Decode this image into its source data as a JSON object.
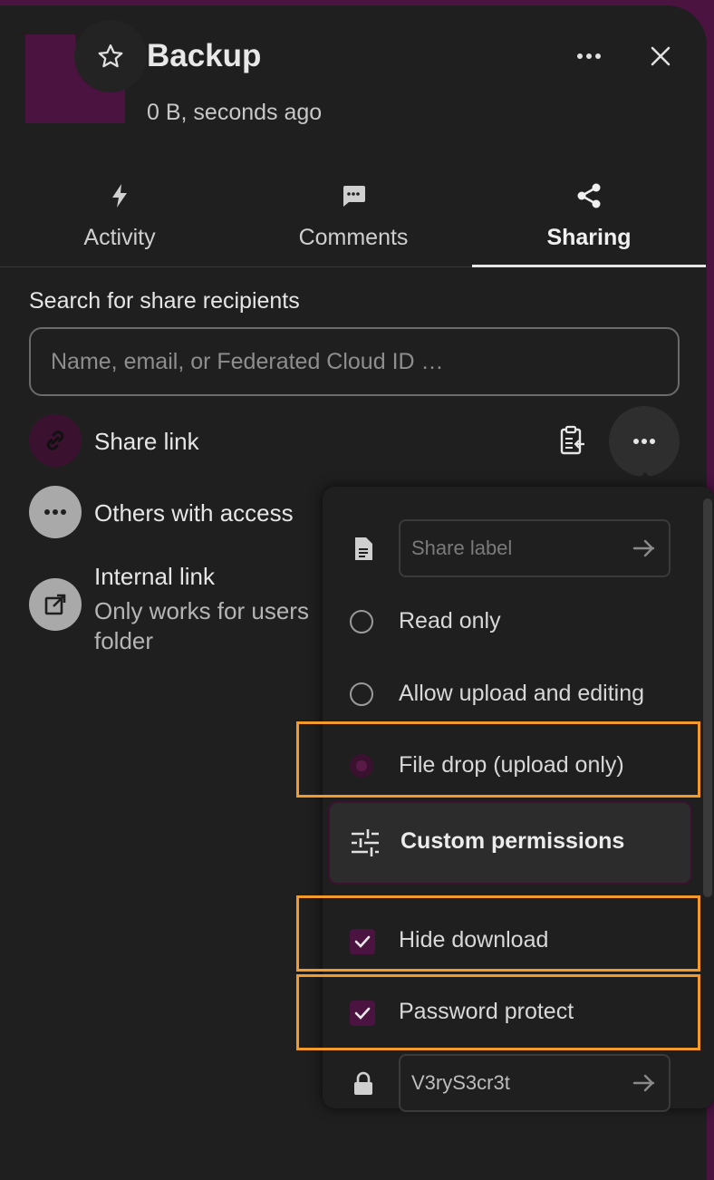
{
  "header": {
    "title": "Backup",
    "subtitle": "0 B, seconds ago"
  },
  "tabs": [
    {
      "label": "Activity",
      "icon": "lightning-icon"
    },
    {
      "label": "Comments",
      "icon": "comment-icon"
    },
    {
      "label": "Sharing",
      "icon": "share-icon",
      "active": true
    }
  ],
  "sharing": {
    "search_label": "Search for share recipients",
    "search_placeholder": "Name, email, or Federated Cloud ID …",
    "share_link_label": "Share link",
    "others_label": "Others with access",
    "internal_link_title": "Internal link",
    "internal_link_sub_1": "Only works for users",
    "internal_link_sub_2": "folder"
  },
  "menu": {
    "share_label_placeholder": "Share label",
    "read_only": "Read only",
    "allow_upload_editing": "Allow upload and editing",
    "file_drop": "File drop (upload only)",
    "custom_permissions": "Custom permissions",
    "hide_download": "Hide download",
    "password_protect": "Password protect",
    "password_value": "V3ryS3cr3t"
  },
  "colors": {
    "accent": "#4a1340",
    "highlight": "#f39a2b",
    "panel_bg": "#1f1f1f"
  }
}
